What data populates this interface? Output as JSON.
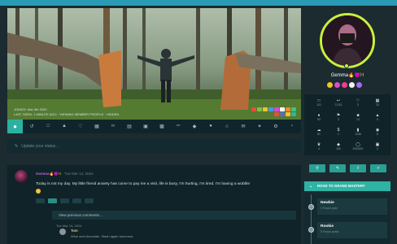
{
  "cover": {
    "joined": "JOINED: Mar 4th 2020",
    "last_seen": "LAST SEEN: 1 MINUTE AGO · VIEWING MEMBER PROFILE · HIDDEN"
  },
  "toolbar": {
    "home_icon": "person-icon",
    "icons": [
      "history-icon",
      "comment-icon",
      "thumbs-up-icon",
      "heart-icon",
      "image-icon",
      "link-icon",
      "calendar-icon",
      "cart-icon",
      "briefcase-icon",
      "dumbbell-icon",
      "tags-icon",
      "user-group-icon",
      "trophy-icon",
      "envelope-icon",
      "star-icon",
      "settings-icon",
      "chevron-right-icon"
    ]
  },
  "status": {
    "placeholder": "Update your status..."
  },
  "post": {
    "author": "Gemma",
    "author_suffix": "🔥😈H",
    "date": "Tue Mar 14, 2024",
    "text": "Today is not my day. My little friend anxiety has come to pay me a visit, life is busy, I'm hurting, I'm tired. I'm having a wobble",
    "view_previous": "View previous comments...",
    "comment_date": "Tue Mar 14, 2024",
    "comment_author": "Tom",
    "comment_text": "Wine and chocolate. Stash again tomorrow."
  },
  "profile": {
    "name": "Gemma",
    "name_suffix": "🔥😈H",
    "badge_colors": [
      "#f5c518",
      "#d84bd4",
      "#ef3e8f",
      "#f2f2f2",
      "#a46cf0"
    ]
  },
  "stats": [
    {
      "icon": "chat-icon",
      "value": "121"
    },
    {
      "icon": "reply-icon",
      "value": "2,313"
    },
    {
      "icon": "heart-icon",
      "value": "3"
    },
    {
      "icon": "image-icon",
      "value": "23"
    },
    {
      "icon": "users-icon",
      "value": "53"
    },
    {
      "icon": "flag-icon",
      "value": "3"
    },
    {
      "icon": "lock-icon",
      "value": "13"
    },
    {
      "icon": "fire-icon",
      "value": "5"
    },
    {
      "icon": "cloud-icon",
      "value": "81"
    },
    {
      "icon": "dollar-icon",
      "value": "1"
    },
    {
      "icon": "bookmark-icon",
      "value": "1336"
    },
    {
      "icon": "eye-icon",
      "value": "8"
    },
    {
      "icon": "crown-icon",
      "value": "4"
    },
    {
      "icon": "gem-icon",
      "value": "100"
    },
    {
      "icon": "coins-icon",
      "value": "£39,620"
    },
    {
      "icon": "gift-icon",
      "value": "2"
    }
  ],
  "road": {
    "title": "ROAD TO GRAND MASTERY",
    "levels": [
      {
        "name": "Newbie",
        "detail": "1 Forum post"
      },
      {
        "name": "Rookie",
        "detail": "5 Forum posts"
      }
    ]
  },
  "colors": {
    "accent": "#2fb3a3",
    "profile_ring": "#c8f03c",
    "author_name": "#b26ad8"
  }
}
